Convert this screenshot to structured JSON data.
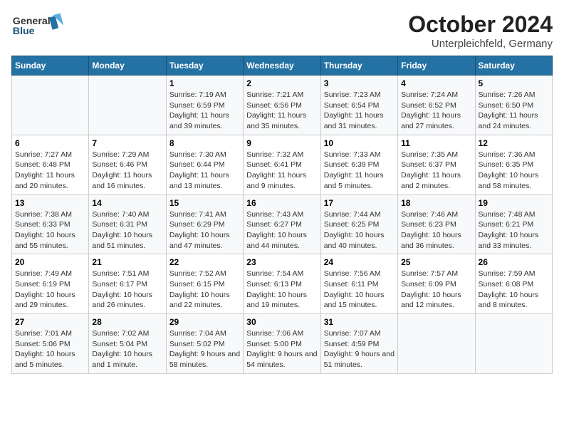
{
  "header": {
    "logo_line1": "General",
    "logo_line2": "Blue",
    "title": "October 2024",
    "subtitle": "Unterpleichfeld, Germany"
  },
  "calendar": {
    "days_of_week": [
      "Sunday",
      "Monday",
      "Tuesday",
      "Wednesday",
      "Thursday",
      "Friday",
      "Saturday"
    ],
    "weeks": [
      [
        {
          "day": "",
          "info": ""
        },
        {
          "day": "",
          "info": ""
        },
        {
          "day": "1",
          "info": "Sunrise: 7:19 AM\nSunset: 6:59 PM\nDaylight: 11 hours and 39 minutes."
        },
        {
          "day": "2",
          "info": "Sunrise: 7:21 AM\nSunset: 6:56 PM\nDaylight: 11 hours and 35 minutes."
        },
        {
          "day": "3",
          "info": "Sunrise: 7:23 AM\nSunset: 6:54 PM\nDaylight: 11 hours and 31 minutes."
        },
        {
          "day": "4",
          "info": "Sunrise: 7:24 AM\nSunset: 6:52 PM\nDaylight: 11 hours and 27 minutes."
        },
        {
          "day": "5",
          "info": "Sunrise: 7:26 AM\nSunset: 6:50 PM\nDaylight: 11 hours and 24 minutes."
        }
      ],
      [
        {
          "day": "6",
          "info": "Sunrise: 7:27 AM\nSunset: 6:48 PM\nDaylight: 11 hours and 20 minutes."
        },
        {
          "day": "7",
          "info": "Sunrise: 7:29 AM\nSunset: 6:46 PM\nDaylight: 11 hours and 16 minutes."
        },
        {
          "day": "8",
          "info": "Sunrise: 7:30 AM\nSunset: 6:44 PM\nDaylight: 11 hours and 13 minutes."
        },
        {
          "day": "9",
          "info": "Sunrise: 7:32 AM\nSunset: 6:41 PM\nDaylight: 11 hours and 9 minutes."
        },
        {
          "day": "10",
          "info": "Sunrise: 7:33 AM\nSunset: 6:39 PM\nDaylight: 11 hours and 5 minutes."
        },
        {
          "day": "11",
          "info": "Sunrise: 7:35 AM\nSunset: 6:37 PM\nDaylight: 11 hours and 2 minutes."
        },
        {
          "day": "12",
          "info": "Sunrise: 7:36 AM\nSunset: 6:35 PM\nDaylight: 10 hours and 58 minutes."
        }
      ],
      [
        {
          "day": "13",
          "info": "Sunrise: 7:38 AM\nSunset: 6:33 PM\nDaylight: 10 hours and 55 minutes."
        },
        {
          "day": "14",
          "info": "Sunrise: 7:40 AM\nSunset: 6:31 PM\nDaylight: 10 hours and 51 minutes."
        },
        {
          "day": "15",
          "info": "Sunrise: 7:41 AM\nSunset: 6:29 PM\nDaylight: 10 hours and 47 minutes."
        },
        {
          "day": "16",
          "info": "Sunrise: 7:43 AM\nSunset: 6:27 PM\nDaylight: 10 hours and 44 minutes."
        },
        {
          "day": "17",
          "info": "Sunrise: 7:44 AM\nSunset: 6:25 PM\nDaylight: 10 hours and 40 minutes."
        },
        {
          "day": "18",
          "info": "Sunrise: 7:46 AM\nSunset: 6:23 PM\nDaylight: 10 hours and 36 minutes."
        },
        {
          "day": "19",
          "info": "Sunrise: 7:48 AM\nSunset: 6:21 PM\nDaylight: 10 hours and 33 minutes."
        }
      ],
      [
        {
          "day": "20",
          "info": "Sunrise: 7:49 AM\nSunset: 6:19 PM\nDaylight: 10 hours and 29 minutes."
        },
        {
          "day": "21",
          "info": "Sunrise: 7:51 AM\nSunset: 6:17 PM\nDaylight: 10 hours and 26 minutes."
        },
        {
          "day": "22",
          "info": "Sunrise: 7:52 AM\nSunset: 6:15 PM\nDaylight: 10 hours and 22 minutes."
        },
        {
          "day": "23",
          "info": "Sunrise: 7:54 AM\nSunset: 6:13 PM\nDaylight: 10 hours and 19 minutes."
        },
        {
          "day": "24",
          "info": "Sunrise: 7:56 AM\nSunset: 6:11 PM\nDaylight: 10 hours and 15 minutes."
        },
        {
          "day": "25",
          "info": "Sunrise: 7:57 AM\nSunset: 6:09 PM\nDaylight: 10 hours and 12 minutes."
        },
        {
          "day": "26",
          "info": "Sunrise: 7:59 AM\nSunset: 6:08 PM\nDaylight: 10 hours and 8 minutes."
        }
      ],
      [
        {
          "day": "27",
          "info": "Sunrise: 7:01 AM\nSunset: 5:06 PM\nDaylight: 10 hours and 5 minutes."
        },
        {
          "day": "28",
          "info": "Sunrise: 7:02 AM\nSunset: 5:04 PM\nDaylight: 10 hours and 1 minute."
        },
        {
          "day": "29",
          "info": "Sunrise: 7:04 AM\nSunset: 5:02 PM\nDaylight: 9 hours and 58 minutes."
        },
        {
          "day": "30",
          "info": "Sunrise: 7:06 AM\nSunset: 5:00 PM\nDaylight: 9 hours and 54 minutes."
        },
        {
          "day": "31",
          "info": "Sunrise: 7:07 AM\nSunset: 4:59 PM\nDaylight: 9 hours and 51 minutes."
        },
        {
          "day": "",
          "info": ""
        },
        {
          "day": "",
          "info": ""
        }
      ]
    ]
  }
}
